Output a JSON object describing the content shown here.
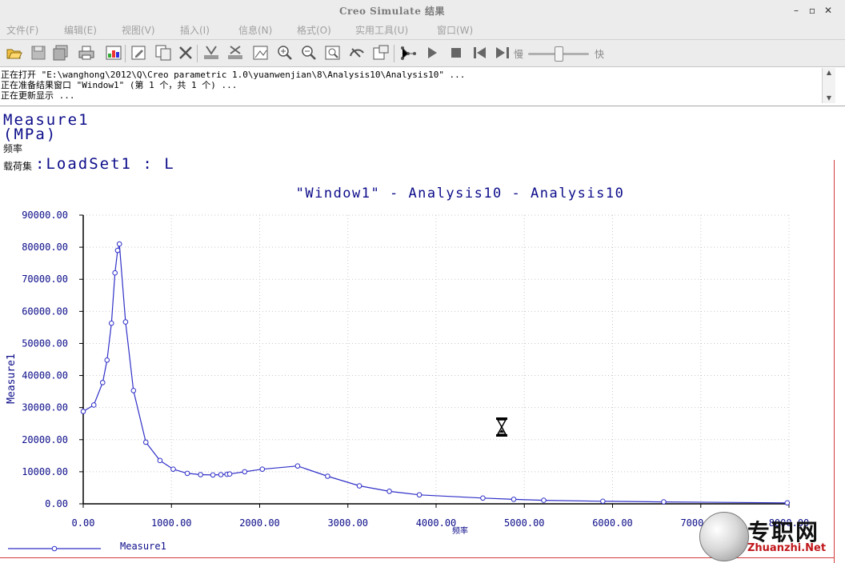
{
  "window": {
    "title": "Creo Simulate 结果"
  },
  "window_controls": {
    "minimize": "–",
    "maximize": "▫",
    "close": "✕"
  },
  "menubar": {
    "items": [
      "文件(F)",
      "编辑(E)",
      "视图(V)",
      "插入(I)",
      "信息(N)",
      "格式(O)",
      "实用工具(U)",
      "窗口(W)"
    ]
  },
  "toolbar": {
    "icons": [
      "open-icon",
      "save-icon",
      "save-as-icon",
      "print-icon",
      "export-icon",
      "edit-icon",
      "copy-icon",
      "delete-icon",
      "query-icon",
      "query-clear-icon",
      "view-settings-icon",
      "zoom-in-icon",
      "zoom-out-icon",
      "zoom-fit-icon",
      "spin-icon",
      "copy-window-icon",
      "animate-icon",
      "play-icon",
      "stop-icon",
      "first-frame-icon",
      "last-frame-icon"
    ],
    "speed_slow": "慢",
    "speed_fast": "快",
    "speed_level": 0.45
  },
  "messages": [
    "正在打开 \"E:\\wanghong\\2012\\Q\\Creo parametric 1.0\\yuanwenjian\\8\\Analysis10\\Analysis10\" ...",
    "正在准备结果窗口 \"Window1\" (第 1 个，共 1 个) ...",
    "正在更新显示 ..."
  ],
  "plot_header": {
    "measure": "Measure1",
    "unit": "(MPa)",
    "x_quantity": "频率",
    "loadset_prefix": "载荷集",
    "loadset_value": ":LoadSet1 :  L"
  },
  "watermark": {
    "cn": "专职网",
    "en": "Zhuanzhi.Net"
  },
  "colors": {
    "line": "#2f2fc8",
    "text": "#0c0c8a",
    "grid": "#c8c8c8",
    "chrome": "#ececec"
  },
  "chart_data": {
    "type": "line",
    "title": "\"Window1\" - Analysis10 - Analysis10",
    "xlabel": "频率",
    "ylabel": "Measure1",
    "xlim": [
      0,
      8000
    ],
    "ylim": [
      0,
      90000
    ],
    "x_ticks": [
      "0.00",
      "1000.00",
      "2000.00",
      "3000.00",
      "4000.00",
      "5000.00",
      "6000.00",
      "7000.00",
      "8000.00"
    ],
    "y_ticks": [
      "0.00",
      "10000.00",
      "20000.00",
      "30000.00",
      "40000.00",
      "50000.00",
      "60000.00",
      "70000.00",
      "80000.00",
      "90000.00"
    ],
    "grid": true,
    "legend_position": "bottom-left",
    "series": [
      {
        "name": "Measure1",
        "x": [
          0,
          120,
          220,
          270,
          320,
          360,
          390,
          410,
          480,
          570,
          710,
          870,
          1020,
          1180,
          1330,
          1470,
          1560,
          1630,
          1660,
          1830,
          2030,
          2430,
          2770,
          3130,
          3470,
          3810,
          4530,
          4880,
          5220,
          5890,
          6580,
          7980
        ],
        "y": [
          28800,
          30800,
          37800,
          44800,
          56300,
          72000,
          79000,
          81000,
          56700,
          35300,
          19200,
          13500,
          10800,
          9500,
          9100,
          9000,
          9100,
          9200,
          9300,
          10000,
          10800,
          11800,
          8600,
          5600,
          3900,
          2800,
          1800,
          1400,
          1100,
          800,
          600,
          300
        ]
      }
    ]
  }
}
